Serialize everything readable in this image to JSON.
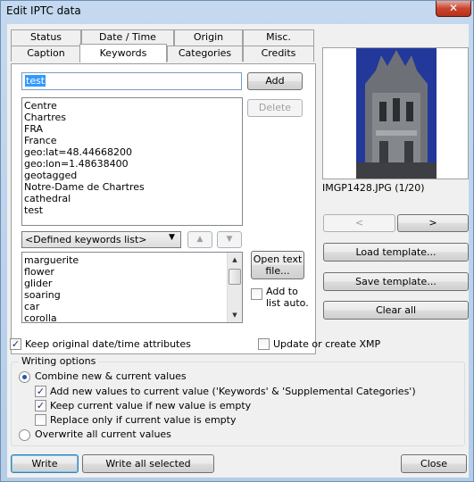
{
  "window": {
    "title": "Edit IPTC data",
    "close_glyph": "✕"
  },
  "tabs_row1": [
    "Status",
    "Date / Time",
    "Origin",
    "Misc."
  ],
  "tabs_row2": [
    "Caption",
    "Keywords",
    "Categories",
    "Credits"
  ],
  "active_tab": "Keywords",
  "keywords": {
    "input_value": "test",
    "add_label": "Add",
    "delete_label": "Delete",
    "items": [
      "Centre",
      "Chartres",
      "FRA",
      "France",
      "geo:lat=48.44668200",
      "geo:lon=1.48638400",
      "geotagged",
      "Notre-Dame de Chartres",
      "cathedral",
      "test"
    ],
    "defined_dropdown": "<Defined keywords list>",
    "defined_items": [
      "marguerite",
      "flower",
      "glider",
      "soaring",
      "car",
      "corolla"
    ],
    "open_text_file_label": "Open text file...",
    "add_to_list_auto_label": "Add to list auto."
  },
  "photo": {
    "caption": "IMGP1428.JPG (1/20)"
  },
  "nav": {
    "prev": "<",
    "next": ">"
  },
  "side_buttons": {
    "load_template": "Load template...",
    "save_template": "Save template...",
    "clear_all": "Clear all"
  },
  "options": {
    "keep_original_datetime": "Keep original date/time attributes",
    "update_or_create_xmp": "Update or create XMP"
  },
  "writing_options": {
    "legend": "Writing options",
    "combine": "Combine new & current values",
    "add_new_values": "Add new values to current value ('Keywords' & 'Supplemental Categories')",
    "keep_current": "Keep current value if new value is empty",
    "replace_only": "Replace only if current value is empty",
    "overwrite": "Overwrite all current values"
  },
  "footer": {
    "write": "Write",
    "write_all_selected": "Write all selected",
    "close": "Close"
  },
  "colors": {
    "selection": "#3399ff",
    "title_bar": "#c4d9ef",
    "close_button": "#c7452f"
  }
}
